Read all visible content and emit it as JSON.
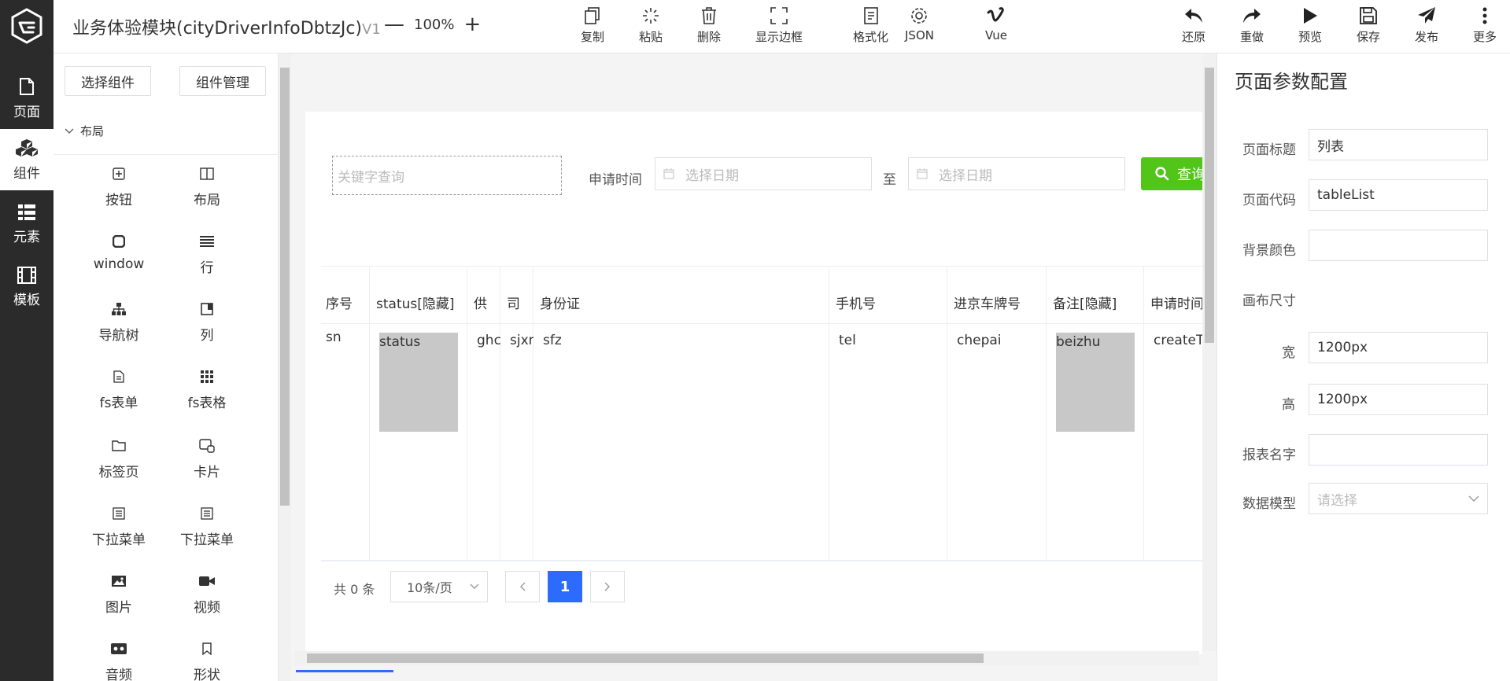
{
  "rail": {
    "items": [
      {
        "label": "页面",
        "icon": "page-icon"
      },
      {
        "label": "组件",
        "icon": "components-icon"
      },
      {
        "label": "元素",
        "icon": "elements-icon"
      },
      {
        "label": "模板",
        "icon": "template-icon"
      }
    ],
    "active": "组件"
  },
  "header": {
    "title": "业务体验模块(cityDriverInfoDbtzJc)",
    "version": "V1",
    "zoom": "100%"
  },
  "toolbar": {
    "copy": "复制",
    "paste": "粘贴",
    "delete": "删除",
    "show_border": "显示边框",
    "format": "格式化",
    "json": "JSON",
    "vue": "Vue",
    "undo": "还原",
    "redo": "重做",
    "preview": "预览",
    "save": "保存",
    "publish": "发布",
    "more": "更多"
  },
  "panel": {
    "select_component": "选择组件",
    "manage_component": "组件管理",
    "group": "布局",
    "components": [
      "按钮",
      "布局",
      "window",
      "行",
      "导航树",
      "列",
      "fs表单",
      "fs表格",
      "标签页",
      "卡片",
      "下拉菜单",
      "下拉菜单",
      "图片",
      "视频",
      "音频",
      "形状"
    ]
  },
  "canvas": {
    "keyword_placeholder": "关键字查询",
    "apply_time_label": "申请时间",
    "date_placeholder_start": "选择日期",
    "to": "至",
    "date_placeholder_end": "选择日期",
    "search_button": "查询",
    "table": {
      "headers": [
        "序号",
        "status[隐藏]",
        "供",
        "司",
        "身份证",
        "手机号",
        "进京车牌号",
        "备注[隐藏]",
        "申请时间"
      ],
      "row": [
        "sn",
        "status",
        "ghc",
        "sjxn",
        "sfz",
        "tel",
        "chepai",
        "beizhu",
        "createT"
      ]
    },
    "pager": {
      "total": "共 0 条",
      "page_size": "10条/页",
      "current": "1"
    }
  },
  "props": {
    "title": "页面参数配置",
    "page_title_label": "页面标题",
    "page_title_value": "列表",
    "page_code_label": "页面代码",
    "page_code_value": "tableList",
    "bg_color_label": "背景颜色",
    "bg_color_value": "",
    "canvas_size_label": "画布尺寸",
    "width_label": "宽",
    "width_value": "1200px",
    "height_label": "高",
    "height_value": "1200px",
    "report_name_label": "报表名字",
    "report_name_value": "",
    "data_model_label": "数据模型",
    "data_model_placeholder": "请选择"
  },
  "colors": {
    "rail_bg": "#2b2b2b",
    "search_green": "#52c41a",
    "pager_blue": "#2d6bff"
  }
}
